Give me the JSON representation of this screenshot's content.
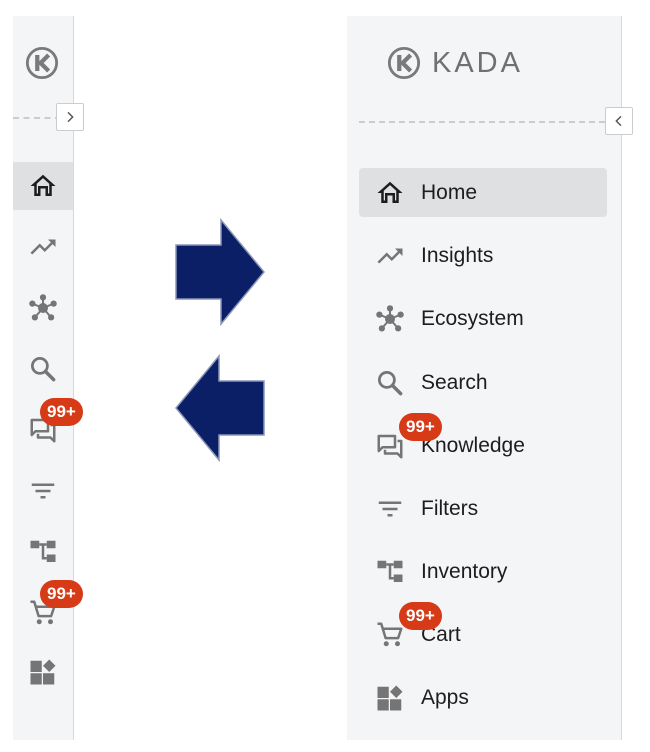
{
  "collapsed_sidebar": {
    "expand_toggle_icon": "chevron-right-icon",
    "items": [
      {
        "icon": "home-icon",
        "active": true
      },
      {
        "icon": "trending-up-icon"
      },
      {
        "icon": "ecosystem-icon"
      },
      {
        "icon": "search-icon"
      },
      {
        "icon": "chat-icon",
        "badge": "99+"
      },
      {
        "icon": "filter-icon"
      },
      {
        "icon": "inventory-icon"
      },
      {
        "icon": "cart-icon",
        "badge": "99+"
      },
      {
        "icon": "apps-icon"
      }
    ]
  },
  "expanded_sidebar": {
    "brand": "KADA",
    "collapse_toggle_icon": "chevron-left-icon",
    "items": [
      {
        "label": "Home",
        "icon": "home-icon",
        "active": true
      },
      {
        "label": "Insights",
        "icon": "trending-up-icon"
      },
      {
        "label": "Ecosystem",
        "icon": "ecosystem-icon"
      },
      {
        "label": "Search",
        "icon": "search-icon"
      },
      {
        "label": "Knowledge",
        "icon": "chat-icon",
        "badge": "99+"
      },
      {
        "label": "Filters",
        "icon": "filter-icon"
      },
      {
        "label": "Inventory",
        "icon": "inventory-icon"
      },
      {
        "label": "Cart",
        "icon": "cart-icon",
        "badge": "99+"
      },
      {
        "label": "Apps",
        "icon": "apps-icon"
      }
    ]
  },
  "colors": {
    "sidebar_bg": "#f4f5f7",
    "active_bg": "#dfe0e2",
    "badge": "#d73a17",
    "arrow_fill": "#0b1f66",
    "icon_gray": "#757575"
  }
}
